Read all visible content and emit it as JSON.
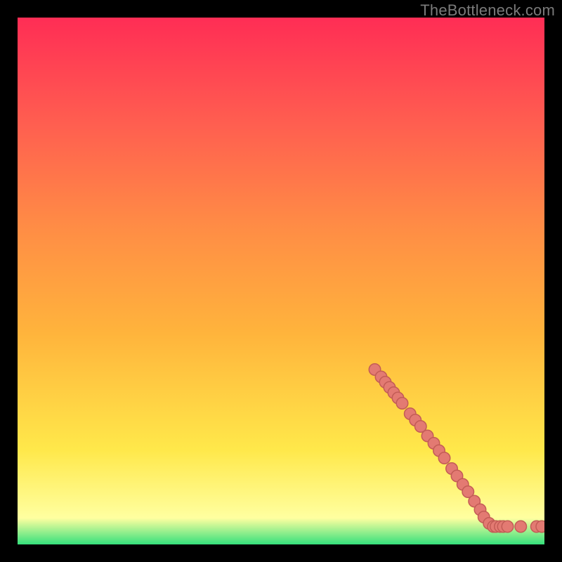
{
  "watermark": "TheBottleneck.com",
  "colors": {
    "marker_fill": "#e37a72",
    "marker_stroke": "#c35c56",
    "line": "#000000"
  },
  "chart_data": {
    "type": "line",
    "title": "",
    "xlabel": "",
    "ylabel": "",
    "xlim": [
      0,
      1
    ],
    "ylim": [
      0,
      1
    ],
    "series": [
      {
        "name": "curve",
        "values": "M0,0 C0.04,0.02 0.08,0.06 0.12,0.11 C0.18,0.18 0.87,0.94 0.87,0.94 C0.89,0.96 0.90,0.965 0.92,0.965 L1.00,0.965"
      },
      {
        "name": "markers",
        "points": [
          {
            "x": 0.678,
            "y": 0.668
          },
          {
            "x": 0.69,
            "y": 0.682
          },
          {
            "x": 0.698,
            "y": 0.692
          },
          {
            "x": 0.706,
            "y": 0.702
          },
          {
            "x": 0.714,
            "y": 0.712
          },
          {
            "x": 0.722,
            "y": 0.722
          },
          {
            "x": 0.73,
            "y": 0.732
          },
          {
            "x": 0.745,
            "y": 0.752
          },
          {
            "x": 0.755,
            "y": 0.764
          },
          {
            "x": 0.765,
            "y": 0.776
          },
          {
            "x": 0.778,
            "y": 0.794
          },
          {
            "x": 0.79,
            "y": 0.808
          },
          {
            "x": 0.8,
            "y": 0.822
          },
          {
            "x": 0.81,
            "y": 0.836
          },
          {
            "x": 0.824,
            "y": 0.856
          },
          {
            "x": 0.834,
            "y": 0.87
          },
          {
            "x": 0.845,
            "y": 0.886
          },
          {
            "x": 0.855,
            "y": 0.9
          },
          {
            "x": 0.867,
            "y": 0.918
          },
          {
            "x": 0.878,
            "y": 0.934
          },
          {
            "x": 0.885,
            "y": 0.948
          },
          {
            "x": 0.895,
            "y": 0.96
          },
          {
            "x": 0.903,
            "y": 0.966
          },
          {
            "x": 0.908,
            "y": 0.966
          },
          {
            "x": 0.916,
            "y": 0.966
          },
          {
            "x": 0.922,
            "y": 0.966
          },
          {
            "x": 0.93,
            "y": 0.966
          },
          {
            "x": 0.955,
            "y": 0.966
          },
          {
            "x": 0.985,
            "y": 0.966
          },
          {
            "x": 0.995,
            "y": 0.966
          }
        ]
      }
    ]
  }
}
